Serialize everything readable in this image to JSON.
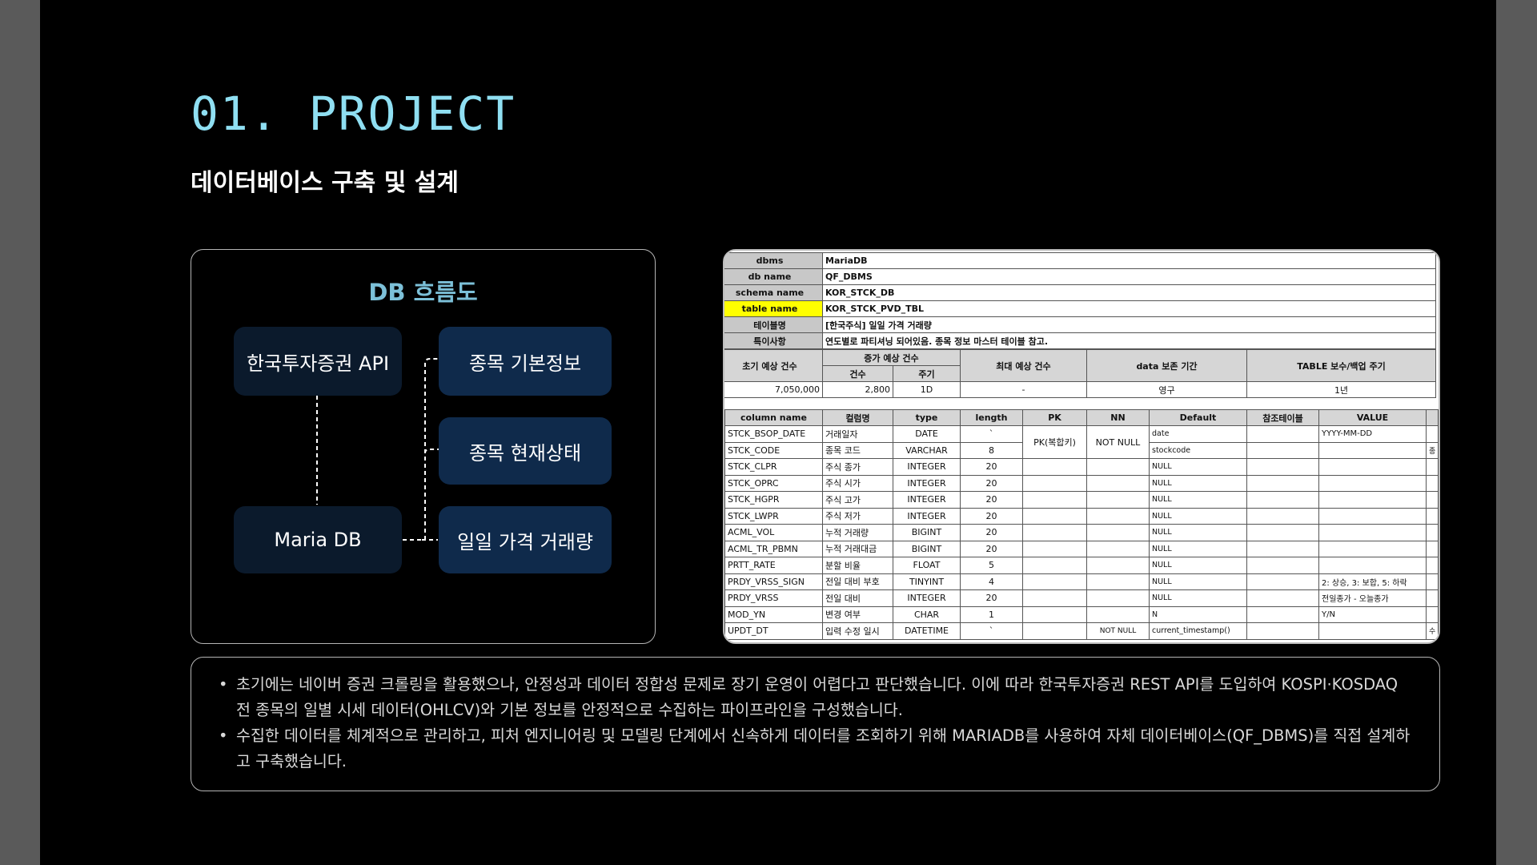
{
  "heading": "01. PROJECT",
  "subheading": "데이터베이스 구축 및 설계",
  "flow": {
    "title": "DB 흐름도",
    "nodes": {
      "api": "한국투자증권 API",
      "db": "Maria DB",
      "basic": "종목 기본정보",
      "status": "종목 현재상태",
      "daily": "일일 가격 거래량"
    }
  },
  "schema": {
    "meta": [
      {
        "key": "dbms",
        "value": "MariaDB"
      },
      {
        "key": "db name",
        "value": "QF_DBMS"
      },
      {
        "key": "schema name",
        "value": "KOR_STCK_DB"
      },
      {
        "key": "table name",
        "value": "KOR_STCK_PVD_TBL"
      },
      {
        "key": "테이블명",
        "value": "[한국주식] 일일 가격 거래량"
      },
      {
        "key": "특이사항",
        "value": "연도별로 파티셔닝 되어있음. 종목 정보 마스터 테이블 참고."
      }
    ],
    "size": {
      "h_initial": "초기 예상 건수",
      "h_increase": "증가 예상 건수",
      "h_count": "건수",
      "h_period": "주기",
      "h_max": "최대 예상 건수",
      "h_retention": "data 보존 기간",
      "h_backup": "TABLE 보수/백업 주기",
      "initial": "7,050,000",
      "count": "2,800",
      "period": "1D",
      "max": "-",
      "retention": "영구",
      "backup": "1년"
    },
    "col_headers": [
      "column name",
      "컬럼명",
      "type",
      "length",
      "PK",
      "NN",
      "Default",
      "참조테이블",
      "VALUE"
    ],
    "pk_label": "PK(복합키)",
    "nn_label": "NOT NULL",
    "rows": [
      {
        "name": "STCK_BSOP_DATE",
        "kor": "거래일자",
        "type": "DATE",
        "len": "`",
        "default": "date",
        "ref": "",
        "value": "YYYY-MM-DD",
        "nn": "",
        "extra": ""
      },
      {
        "name": "STCK_CODE",
        "kor": "종목 코드",
        "type": "VARCHAR",
        "len": "8",
        "default": "stockcode",
        "ref": "",
        "value": "",
        "nn": "",
        "extra": "종"
      },
      {
        "name": "STCK_CLPR",
        "kor": "주식 종가",
        "type": "INTEGER",
        "len": "20",
        "default": "NULL",
        "ref": "",
        "value": "",
        "nn": "",
        "extra": ""
      },
      {
        "name": "STCK_OPRC",
        "kor": "주식 시가",
        "type": "INTEGER",
        "len": "20",
        "default": "NULL",
        "ref": "",
        "value": "",
        "nn": "",
        "extra": ""
      },
      {
        "name": "STCK_HGPR",
        "kor": "주식 고가",
        "type": "INTEGER",
        "len": "20",
        "default": "NULL",
        "ref": "",
        "value": "",
        "nn": "",
        "extra": ""
      },
      {
        "name": "STCK_LWPR",
        "kor": "주식 저가",
        "type": "INTEGER",
        "len": "20",
        "default": "NULL",
        "ref": "",
        "value": "",
        "nn": "",
        "extra": ""
      },
      {
        "name": "ACML_VOL",
        "kor": "누적 거래량",
        "type": "BIGINT",
        "len": "20",
        "default": "NULL",
        "ref": "",
        "value": "",
        "nn": "",
        "extra": ""
      },
      {
        "name": "ACML_TR_PBMN",
        "kor": "누적 거래대금",
        "type": "BIGINT",
        "len": "20",
        "default": "NULL",
        "ref": "",
        "value": "",
        "nn": "",
        "extra": ""
      },
      {
        "name": "PRTT_RATE",
        "kor": "분할 비율",
        "type": "FLOAT",
        "len": "5",
        "default": "NULL",
        "ref": "",
        "value": "",
        "nn": "",
        "extra": ""
      },
      {
        "name": "PRDY_VRSS_SIGN",
        "kor": "전일 대비 부호",
        "type": "TINYINT",
        "len": "4",
        "default": "NULL",
        "ref": "",
        "value": "2: 상승, 3: 보합, 5: 하락",
        "nn": "",
        "extra": ""
      },
      {
        "name": "PRDY_VRSS",
        "kor": "전일 대비",
        "type": "INTEGER",
        "len": "20",
        "default": "NULL",
        "ref": "",
        "value": "전일종가 - 오늘종가",
        "nn": "",
        "extra": ""
      },
      {
        "name": "MOD_YN",
        "kor": "변경 여부",
        "type": "CHAR",
        "len": "1",
        "default": "N",
        "ref": "",
        "value": "Y/N",
        "nn": "",
        "extra": ""
      },
      {
        "name": "UPDT_DT",
        "kor": "입력 수정 일시",
        "type": "DATETIME",
        "len": "`",
        "default": "current_timestamp()",
        "ref": "",
        "value": "",
        "nn": "NOT NULL",
        "extra": "수"
      }
    ]
  },
  "description": [
    "초기에는 네이버 증권 크롤링을 활용했으나, 안정성과 데이터 정합성 문제로 장기 운영이 어렵다고 판단했습니다. 이에 따라 한국투자증권 REST API를 도입하여 KOSPI·KOSDAQ 전 종목의 일별 시세 데이터(OHLCV)와 기본 정보를 안정적으로 수집하는 파이프라인을 구성했습니다.",
    "수집한 데이터를 체계적으로 관리하고, 피처 엔지니어링 및 모델링 단계에서 신속하게 데이터를 조회하기 위해 MARIADB를 사용하여 자체 데이터베이스(QF_DBMS)를 직접 설계하고 구축했습니다."
  ]
}
